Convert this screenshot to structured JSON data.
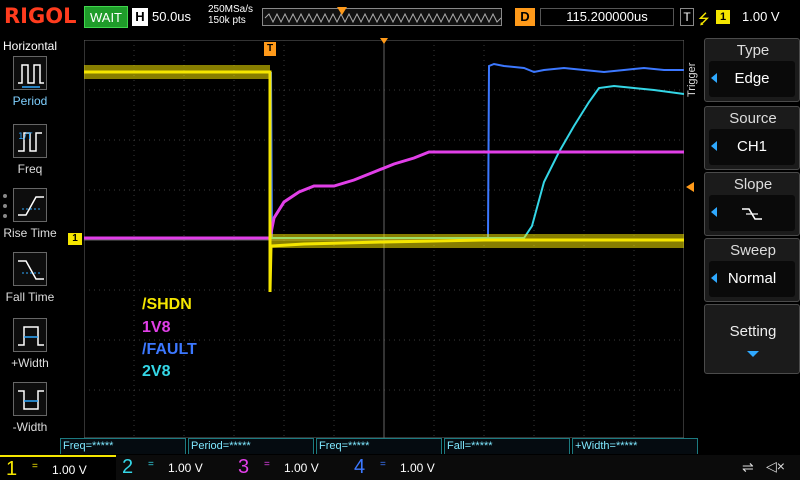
{
  "topbar": {
    "brand": "RIGOL",
    "run_status": "WAIT",
    "horizontal_chip": "H",
    "timebase": "50.0us",
    "sample_rate": "250MSa/s",
    "memory_depth": "150k pts",
    "delay_chip": "D",
    "delay": "115.200000us",
    "trigger_chip": "T",
    "trigger_edge_symbol": "⭍",
    "trigger_source": "1",
    "trigger_level": "1.00 V"
  },
  "leftbar": {
    "title": "Horizontal",
    "items": [
      {
        "label": "Period",
        "icon": "period-icon"
      },
      {
        "label": "Freq",
        "icon": "frequency-icon"
      },
      {
        "label": "Rise Time",
        "icon": "rise-time-icon"
      },
      {
        "label": "Fall Time",
        "icon": "fall-time-icon"
      },
      {
        "label": "+Width",
        "icon": "positive-width-icon"
      },
      {
        "label": "-Width",
        "icon": "negative-width-icon"
      }
    ]
  },
  "legend": {
    "l1": "/SHDN",
    "l2": "1V8",
    "l3": "/FAULT",
    "l4": "2V8"
  },
  "markers": {
    "trigger_top": "T",
    "ch1_level": "1"
  },
  "rightpanel": {
    "side_label": "Trigger",
    "type": {
      "title": "Type",
      "value": "Edge"
    },
    "source": {
      "title": "Source",
      "value": "CH1"
    },
    "slope": {
      "title": "Slope",
      "value": "rising-edge-symbol"
    },
    "sweep": {
      "title": "Sweep",
      "value": "Normal"
    },
    "setting": {
      "title": "Setting"
    }
  },
  "measurements": [
    "Freq=*****",
    "Period=*****",
    "Freq=*****",
    "Fall=*****",
    "+Width=*****"
  ],
  "channels": [
    {
      "num": "1",
      "coupling": "=",
      "scale": "1.00 V"
    },
    {
      "num": "2",
      "coupling": "=",
      "scale": "1.00 V"
    },
    {
      "num": "3",
      "coupling": "=",
      "scale": "1.00 V"
    },
    {
      "num": "4",
      "coupling": "=",
      "scale": "1.00 V"
    }
  ],
  "colors": {
    "ch1": "#f5e600",
    "ch2": "#34d6e6",
    "ch3": "#e13fe8",
    "ch4": "#3c78ff",
    "brand": "#ff3c1e",
    "status": "#1f9c2a"
  }
}
